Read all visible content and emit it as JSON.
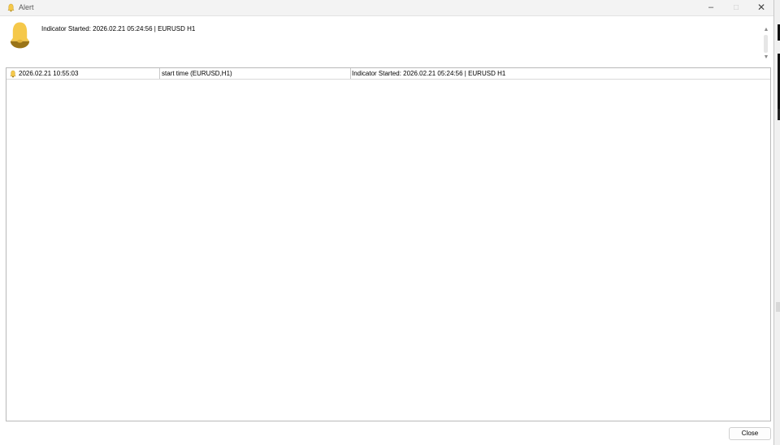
{
  "window": {
    "title": "Alert",
    "controls": {
      "minimize": "–",
      "maximize": "□",
      "close": "✕"
    }
  },
  "header": {
    "message": "Indicator Started: 2026.02.21 05:24:56 | EURUSD H1",
    "icon": "bell-icon"
  },
  "alerts": [
    {
      "time": "2026.02.21 10:55:03",
      "source": "start time (EURUSD,H1)",
      "message": "Indicator Started: 2026.02.21 05:24:56 | EURUSD H1"
    }
  ],
  "footer": {
    "close_label": "Close"
  },
  "colors": {
    "bell_fill": "#f5c84a",
    "bell_shade": "#9a7418",
    "grid_line": "#d9d9d9",
    "border": "#b9b9b9"
  }
}
